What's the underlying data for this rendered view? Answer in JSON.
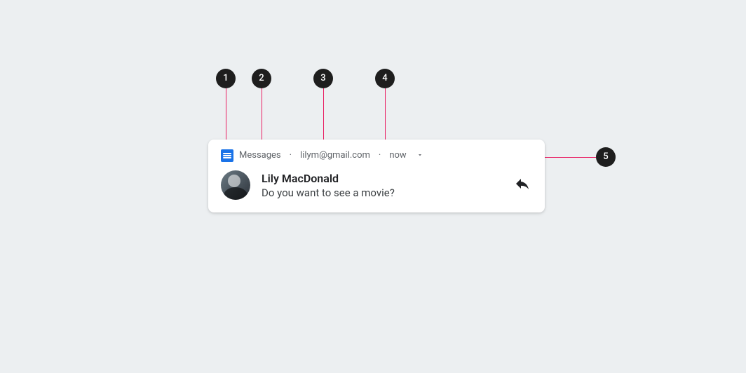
{
  "annotations": {
    "b1": "1",
    "b2": "2",
    "b3": "3",
    "b4": "4",
    "b5": "5"
  },
  "notification": {
    "app_name": "Messages",
    "account": "lilym@gmail.com",
    "timestamp": "now",
    "sender": "Lily MacDonald",
    "message": "Do you want to see a movie?"
  }
}
